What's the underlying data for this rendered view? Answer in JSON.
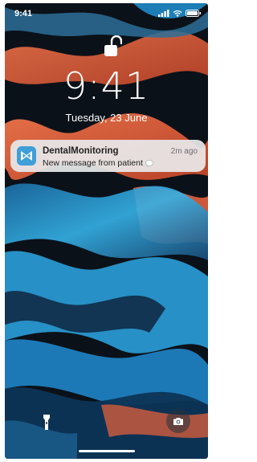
{
  "status_bar": {
    "time": "9:41",
    "icons": [
      "signal-icon",
      "wifi-icon",
      "battery-icon"
    ]
  },
  "lock_screen": {
    "lock_icon": "unlocked-padlock-icon",
    "clock": "9:41",
    "date": "Tuesday, 23 June"
  },
  "notification": {
    "app_name": "DentalMonitoring",
    "time_ago": "2m ago",
    "message": "New message from patient",
    "message_icon": "speech-bubble-icon",
    "app_icon_color": "#3f9fd6"
  },
  "quick_actions": {
    "left": "flashlight-icon",
    "right": "camera-icon"
  },
  "colors": {
    "wallpaper_orange": "#e8623a",
    "wallpaper_blue": "#2aa2de",
    "wallpaper_dark": "#0b1118",
    "notification_bg": "#e8e8ea"
  }
}
